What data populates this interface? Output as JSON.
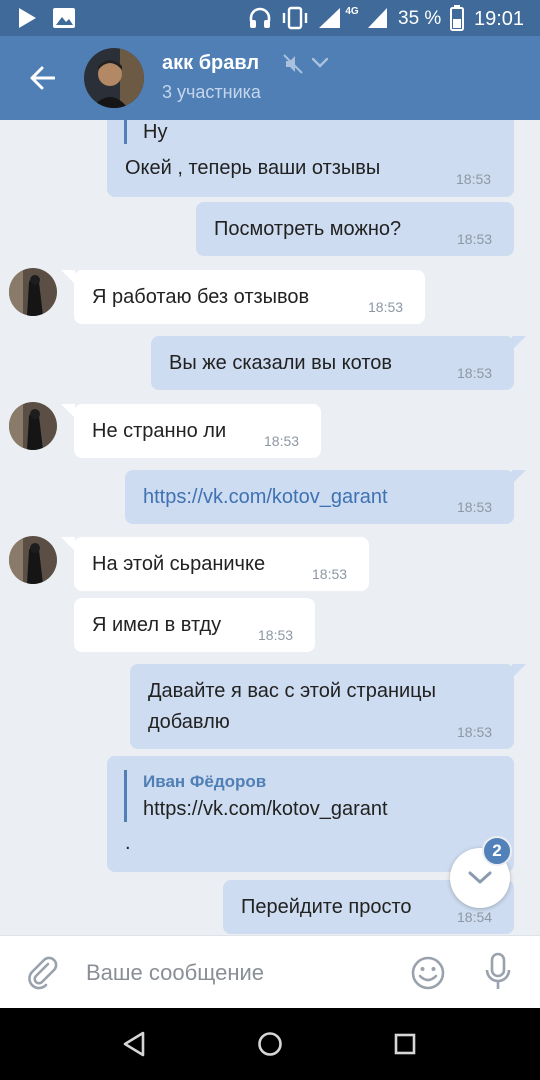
{
  "status_bar": {
    "battery_percent": "35 %",
    "time": "19:01",
    "network": "4G",
    "icons": [
      "play-icon",
      "image-icon",
      "headphones-icon",
      "vibrate-icon",
      "signal-icon",
      "signal-icon",
      "battery-icon"
    ]
  },
  "header": {
    "title": "акк бравл",
    "subtitle": "3 участника",
    "icons": [
      "back-arrow-icon",
      "mute-icon",
      "chevron-down-icon"
    ]
  },
  "messages": [
    {
      "dir": "out",
      "reply_text": "Ну",
      "text": "Окей , теперь ваши отзывы",
      "time": "18:53"
    },
    {
      "dir": "out",
      "text": "Посмотреть можно?",
      "time": "18:53"
    },
    {
      "dir": "in",
      "text": "Я работаю без отзывов",
      "time": "18:53"
    },
    {
      "dir": "out",
      "text": "Вы же сказали вы котов",
      "time": "18:53"
    },
    {
      "dir": "in",
      "text": "Не странно ли",
      "time": "18:53"
    },
    {
      "dir": "out",
      "text": "https://vk.com/kotov_garant",
      "time": "18:53"
    },
    {
      "dir": "in",
      "text": "На этой сьраничке",
      "time": "18:53"
    },
    {
      "dir": "in",
      "text": "Я имел в втду",
      "time": "18:53"
    },
    {
      "dir": "out",
      "text_line1": "Давайте я вас с этой страницы",
      "text_line2": "добавлю",
      "time": "18:53"
    },
    {
      "dir": "out",
      "reply_author": "Иван Фёдоров",
      "reply_text": "https://vk.com/kotov_garant",
      "text": "."
    },
    {
      "dir": "out",
      "text": "Перейдите просто",
      "time": "18:54"
    }
  ],
  "scroll_badge": "2",
  "composer": {
    "placeholder": "Ваше сообщение",
    "icons": [
      "attach-icon",
      "emoji-icon",
      "microphone-icon"
    ]
  },
  "colors": {
    "header": "#4f7fb5",
    "status_bar": "#3f6a99",
    "outgoing_bubble": "#cddcf0",
    "incoming_bubble": "#ffffff",
    "chat_background": "#ebeef2",
    "link": "#3f72b3",
    "badge": "#5181b8"
  }
}
